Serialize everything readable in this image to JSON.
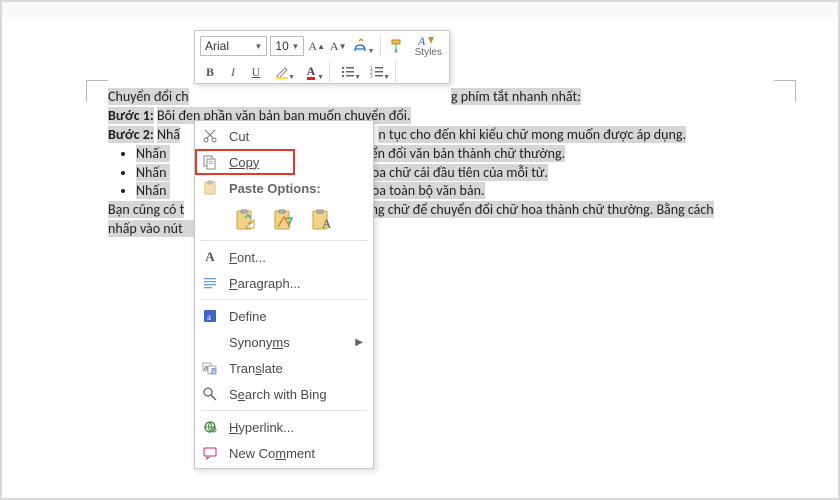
{
  "doc": {
    "line1_a": "Chuyển đổi ch",
    "line1_b": "g phím tắt nhanh nhất:",
    "step1_label": "Bước 1:",
    "step1_text": " Bôi đen phần văn bản bạn muốn chuyển đổi.",
    "step2_label": "Bước 2:",
    "step2_a": " Nhấ",
    "step2_b": "n tục cho đến khi kiểu chữ mong muốn được áp dụng.",
    "bullet_prefix": "Nhấn ",
    "bullet1_tail": "huyển đổi văn bản thành chữ thường.",
    "bullet2_tail": "ết hoa chữ cái đầu tiên của mỗi từ.",
    "bullet3_tail": "ết hoa toàn bộ văn bản.",
    "para2_a": "Bạn cũng có t",
    "para2_b": "ng chữ để chuyển đổi chữ hoa thành chữ thường. Bằng cách",
    "para3": "nhấp vào nút "
  },
  "mini": {
    "font_name": "Arial",
    "font_size": "10",
    "styles_label": "Styles"
  },
  "menu": {
    "cut": "Cut",
    "copy": "Copy",
    "paste_options": "Paste Options:",
    "font": "Font...",
    "paragraph": "Paragraph...",
    "define": "Define",
    "synonyms": "Synonyms",
    "translate": "Translate",
    "search_bing": "Search with Bing",
    "hyperlink": "Hyperlink...",
    "new_comment": "New Comment"
  }
}
